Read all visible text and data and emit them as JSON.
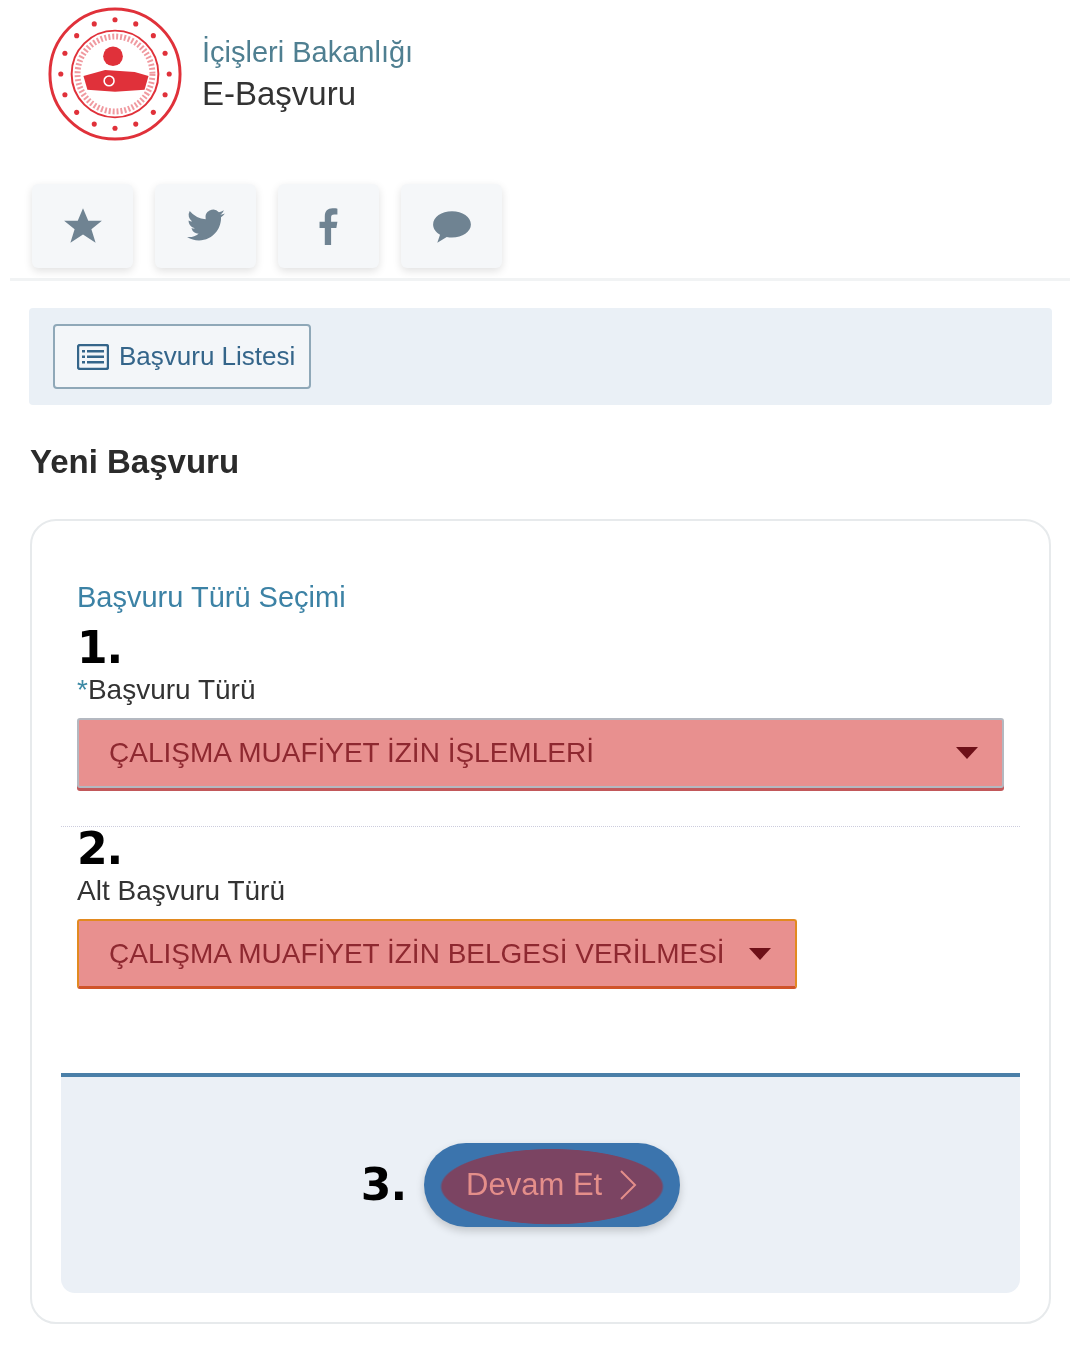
{
  "header": {
    "ministry": "İçişleri Bakanlığı",
    "app_name": "E-Başvuru"
  },
  "social_buttons": [
    {
      "kind": "star"
    },
    {
      "kind": "twitter"
    },
    {
      "kind": "facebook"
    },
    {
      "kind": "chat"
    }
  ],
  "list_button": {
    "label": "Başvuru Listesi"
  },
  "page_title": "Yeni Başvuru",
  "form": {
    "section_title": "Başvuru Türü Seçimi",
    "fields": [
      {
        "step": "1.",
        "marker": "*",
        "label": "Başvuru Türü",
        "value": "ÇALIŞMA MUAFİYET İZİN İŞLEMLERİ",
        "wide": true
      },
      {
        "step": "2.",
        "label": "Alt Başvuru Türü",
        "value": "ÇALIŞMA MUAFİYET İZİN BELGESİ VERİLMESİ",
        "wide": false
      }
    ],
    "submit": {
      "step": "3.",
      "label": "Devam Et"
    }
  }
}
